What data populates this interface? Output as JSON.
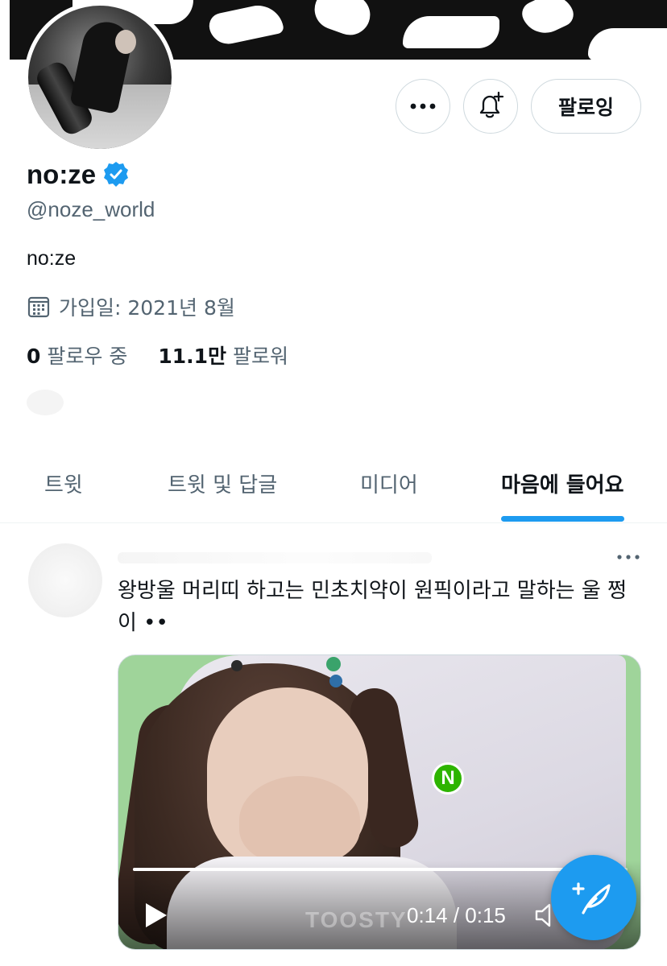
{
  "profile": {
    "display_name": "no:ze",
    "handle": "@noze_world",
    "bio": "no:ze",
    "joined": "가입일: 2021년 8월",
    "following_count": "0",
    "following_label": "팔로우 중",
    "followers_count": "11.1만",
    "followers_label": "팔로워",
    "verified": true
  },
  "actions": {
    "more_icon": "more-horizontal-icon",
    "bell_icon": "notification-bell-plus-icon",
    "following_label": "팔로잉"
  },
  "tabs": [
    {
      "label": "트윗",
      "active": false
    },
    {
      "label": "트윗 및 답글",
      "active": false
    },
    {
      "label": "미디어",
      "active": false
    },
    {
      "label": "마음에 들어요",
      "active": true
    }
  ],
  "tweet": {
    "text": "왕방울 머리띠 하고는 민초치약이 원픽이라고 말하는 울 쩡이 ••",
    "media": {
      "type": "video",
      "time": "0:14 / 0:15",
      "progress": 0.93,
      "badge": "N",
      "watermark": "TOOSTY"
    }
  },
  "colors": {
    "accent": "#1d9bf0",
    "text_primary": "#0f1419",
    "text_secondary": "#536471",
    "border": "#cfd9de"
  }
}
